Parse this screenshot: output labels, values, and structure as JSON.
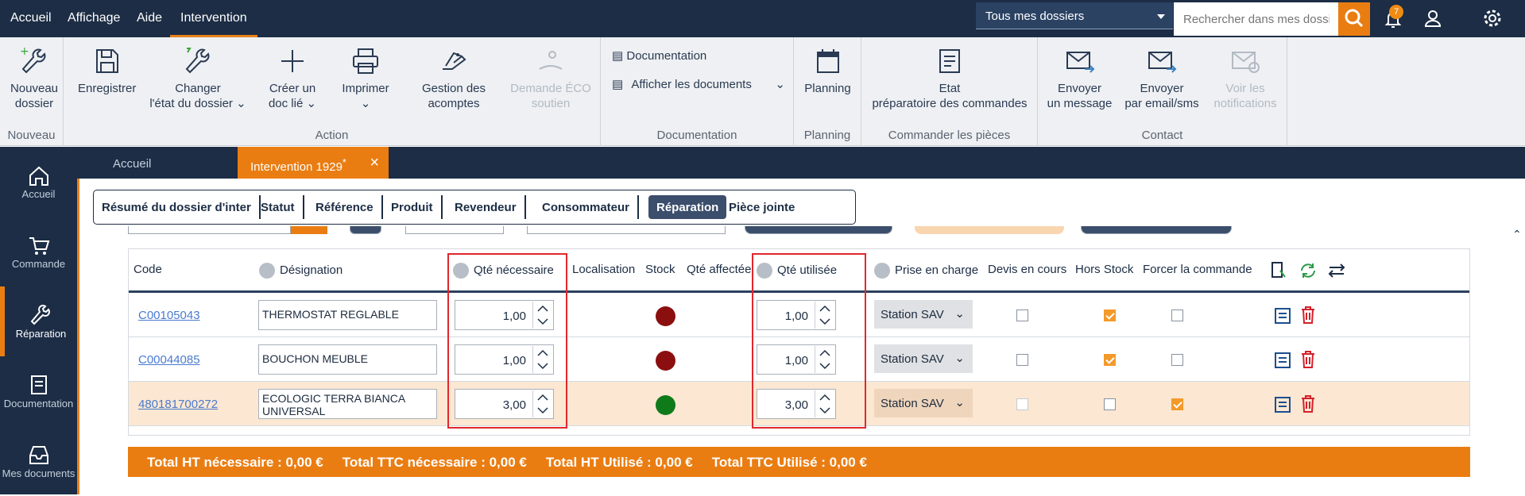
{
  "menu": {
    "items": [
      "Accueil",
      "Affichage",
      "Aide",
      "Intervention"
    ],
    "active": "Intervention"
  },
  "top": {
    "folder_select": "Tous mes dossiers",
    "search_placeholder": "Rechercher dans mes dossier",
    "notification_count": "7"
  },
  "ribbon": {
    "nouveau": {
      "label": "Nouveau",
      "new_folder": [
        "Nouveau",
        "dossier"
      ]
    },
    "action": {
      "label": "Action",
      "save": "Enregistrer",
      "change_state": [
        "Changer",
        "l'état du dossier"
      ],
      "create_doc": [
        "Créer un",
        "doc lié"
      ],
      "print": "Imprimer",
      "deposits": [
        "Gestion des",
        "acomptes"
      ],
      "eco": [
        "Demande ÉCO",
        "soutien"
      ]
    },
    "documentation": {
      "label": "Documentation",
      "doc": "Documentation",
      "show_docs": "Afficher les documents"
    },
    "planning": {
      "label": "Planning",
      "planning": "Planning"
    },
    "commander": {
      "label": "Commander les pièces",
      "state": [
        "Etat",
        "préparatoire des commandes"
      ]
    },
    "contact": {
      "label": "Contact",
      "send_message": [
        "Envoyer",
        "un message"
      ],
      "send_email": [
        "Envoyer",
        "par email/sms"
      ],
      "notifications": [
        "Voir les",
        "notifications"
      ]
    }
  },
  "leftnav": {
    "items": [
      "Accueil",
      "Commande",
      "Réparation",
      "Documentation",
      "Mes documents"
    ],
    "active": "Réparation"
  },
  "tabs": {
    "home": "Accueil",
    "current": "Intervention 1929",
    "modified_mark": "*"
  },
  "subtabs": [
    "Résumé du dossier d'inter",
    "Statut",
    "Référence",
    "Produit",
    "Revendeur",
    "Consommateur",
    "Réparation",
    "Pièce jointe"
  ],
  "subtab_active": "Réparation",
  "table": {
    "headers": {
      "code": "Code",
      "designation": "Désignation",
      "qte_necessaire": "Qté nécessaire",
      "localisation": "Localisation",
      "stock": "Stock",
      "qte_affectee": "Qté affectée",
      "qte_utilisee": "Qté utilisée",
      "prise_en_charge": "Prise en charge",
      "devis": "Devis en cours",
      "hors_stock": "Hors Stock",
      "forcer": "Forcer la commande"
    },
    "rows": [
      {
        "code": "C00105043",
        "designation": "THERMOSTAT REGLABLE",
        "qte_necessaire": "1,00",
        "qte_utilisee": "1,00",
        "stock_color": "#8b0f0f",
        "prise": "Station SAV",
        "devis": false,
        "hors_stock": true,
        "forcer": false,
        "highlight": false
      },
      {
        "code": "C00044085",
        "designation": "BOUCHON MEUBLE",
        "qte_necessaire": "1,00",
        "qte_utilisee": "1,00",
        "stock_color": "#8b0f0f",
        "prise": "Station SAV",
        "devis": false,
        "hors_stock": true,
        "forcer": false,
        "highlight": false
      },
      {
        "code": "480181700272",
        "designation": "ECOLOGIC TERRA BIANCA UNIVERSAL",
        "qte_necessaire": "3,00",
        "qte_utilisee": "3,00",
        "stock_color": "#0f7a1a",
        "prise": "Station SAV",
        "devis": false,
        "hors_stock": false,
        "forcer": true,
        "highlight": true
      }
    ]
  },
  "totals": {
    "ht_necessaire": "Total HT nécessaire : 0,00 €",
    "ttc_necessaire": "Total TTC nécessaire : 0,00 €",
    "ht_utilise": "Total HT Utilisé : 0,00 €",
    "ttc_utilise": "Total TTC Utilisé : 0,00 €"
  },
  "colors": {
    "navy": "#1c2d45",
    "accent": "#ea7d12",
    "link": "#4a7bd0",
    "highlight_row": "#fbe7d2",
    "annotation": "#e0282d"
  }
}
